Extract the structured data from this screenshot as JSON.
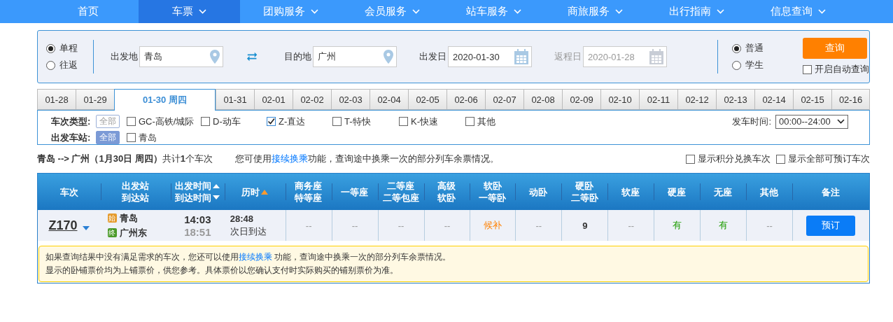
{
  "nav": [
    {
      "label": "首页",
      "selected": false,
      "dropdown": false
    },
    {
      "label": "车票",
      "selected": true,
      "dropdown": true
    },
    {
      "label": "团购服务",
      "selected": false,
      "dropdown": true
    },
    {
      "label": "会员服务",
      "selected": false,
      "dropdown": true
    },
    {
      "label": "站车服务",
      "selected": false,
      "dropdown": true
    },
    {
      "label": "商旅服务",
      "selected": false,
      "dropdown": true
    },
    {
      "label": "出行指南",
      "selected": false,
      "dropdown": true
    },
    {
      "label": "信息查询",
      "selected": false,
      "dropdown": true
    }
  ],
  "search": {
    "trip_types": [
      {
        "label": "单程",
        "selected": true
      },
      {
        "label": "往返",
        "selected": false
      }
    ],
    "from": {
      "label": "出发地",
      "value": "青岛"
    },
    "to": {
      "label": "目的地",
      "value": "广州"
    },
    "depart_date": {
      "label": "出发日",
      "value": "2020-01-30",
      "disabled": false
    },
    "return_date": {
      "label": "返程日",
      "value": "2020-01-28",
      "disabled": true
    },
    "passenger_types": [
      {
        "label": "普通",
        "selected": true
      },
      {
        "label": "学生",
        "selected": false
      }
    ],
    "query_button": "查询",
    "auto_query": {
      "label": "开启自动查询",
      "checked": false
    }
  },
  "date_tabs": [
    {
      "label": "01-28",
      "selected": false
    },
    {
      "label": "01-29",
      "selected": false
    },
    {
      "label": "01-30 周四",
      "selected": true
    },
    {
      "label": "01-31",
      "selected": false
    },
    {
      "label": "02-01",
      "selected": false
    },
    {
      "label": "02-02",
      "selected": false
    },
    {
      "label": "02-03",
      "selected": false
    },
    {
      "label": "02-04",
      "selected": false
    },
    {
      "label": "02-05",
      "selected": false
    },
    {
      "label": "02-06",
      "selected": false
    },
    {
      "label": "02-07",
      "selected": false
    },
    {
      "label": "02-08",
      "selected": false
    },
    {
      "label": "02-09",
      "selected": false
    },
    {
      "label": "02-10",
      "selected": false
    },
    {
      "label": "02-11",
      "selected": false
    },
    {
      "label": "02-12",
      "selected": false
    },
    {
      "label": "02-13",
      "selected": false
    },
    {
      "label": "02-14",
      "selected": false
    },
    {
      "label": "02-15",
      "selected": false
    },
    {
      "label": "02-16",
      "selected": false
    }
  ],
  "filters": {
    "train_type": {
      "label": "车次类型:",
      "all": {
        "label": "全部",
        "selected": false
      },
      "options": [
        {
          "label": "GC-高铁/城际",
          "checked": false
        },
        {
          "label": "D-动车",
          "checked": false
        },
        {
          "label": "Z-直达",
          "checked": true
        },
        {
          "label": "T-特快",
          "checked": false
        },
        {
          "label": "K-快速",
          "checked": false
        },
        {
          "label": "其他",
          "checked": false
        }
      ]
    },
    "station": {
      "label": "出发车站:",
      "all": {
        "label": "全部",
        "selected": true
      },
      "options": [
        {
          "label": "青岛",
          "checked": false
        }
      ]
    },
    "time": {
      "label": "发车时间:",
      "value": "00:00--24:00"
    }
  },
  "summary": {
    "route": "**青岛 --> 广州（1月30日 周四）**共计**1**个车次",
    "tip_before": "您可使用",
    "tip_link": "接续换乘",
    "tip_after": "功能，查询途中换乘一次的部分列车余票情况。",
    "options": [
      {
        "label": "显示积分兑换车次",
        "checked": false
      },
      {
        "label": "显示全部可预订车次",
        "checked": false
      }
    ]
  },
  "table": {
    "columns": [
      {
        "lines": [
          "车次"
        ],
        "kind": "plain"
      },
      {
        "lines": [
          "出发站",
          "到达站"
        ],
        "kind": "plain"
      },
      {
        "lines": [
          "出发时间",
          "到达时间"
        ],
        "kind": "sortboth"
      },
      {
        "lines": [
          "历时"
        ],
        "kind": "sortup"
      },
      {
        "lines": [
          "商务座",
          "特等座"
        ],
        "kind": "plain"
      },
      {
        "lines": [
          "一等座"
        ],
        "kind": "plain"
      },
      {
        "lines": [
          "二等座",
          "二等包座"
        ],
        "kind": "plain"
      },
      {
        "lines": [
          "高级",
          "软卧"
        ],
        "kind": "plain"
      },
      {
        "lines": [
          "软卧",
          "一等卧"
        ],
        "kind": "plain"
      },
      {
        "lines": [
          "动卧"
        ],
        "kind": "plain"
      },
      {
        "lines": [
          "硬卧",
          "二等卧"
        ],
        "kind": "plain"
      },
      {
        "lines": [
          "软座"
        ],
        "kind": "plain"
      },
      {
        "lines": [
          "硬座"
        ],
        "kind": "plain"
      },
      {
        "lines": [
          "无座"
        ],
        "kind": "plain"
      },
      {
        "lines": [
          "其他"
        ],
        "kind": "plain"
      },
      {
        "lines": [
          "备注"
        ],
        "kind": "plain"
      }
    ],
    "rows": [
      {
        "train": "Z170",
        "expanded": false,
        "from": {
          "badge": "始",
          "name": "青岛"
        },
        "to": {
          "badge": "终",
          "name": "广州东"
        },
        "depart": "14:03",
        "arrive": "18:51",
        "duration": "28:48",
        "arrival_day": "次日到达",
        "seats": [
          {
            "text": "--",
            "kind": "none"
          },
          {
            "text": "--",
            "kind": "none"
          },
          {
            "text": "--",
            "kind": "none"
          },
          {
            "text": "--",
            "kind": "none"
          },
          {
            "text": "候补",
            "kind": "waitlist"
          },
          {
            "text": "--",
            "kind": "none"
          },
          {
            "text": "9",
            "kind": "count"
          },
          {
            "text": "--",
            "kind": "none"
          },
          {
            "text": "有",
            "kind": "available"
          },
          {
            "text": "有",
            "kind": "available"
          },
          {
            "text": "--",
            "kind": "none"
          }
        ],
        "action": "预订"
      }
    ]
  },
  "notice": {
    "line1_before": "如果查询结果中没有满足需求的车次，您还可以使用",
    "line1_link": "接续换乘",
    "line1_after": " 功能，查询途中换乘一次的部分列车余票情况。",
    "line2": "显示的卧铺票价均为上铺票价，供您参考。具体票价以您确认支付时实际购买的铺别票价为准。"
  }
}
